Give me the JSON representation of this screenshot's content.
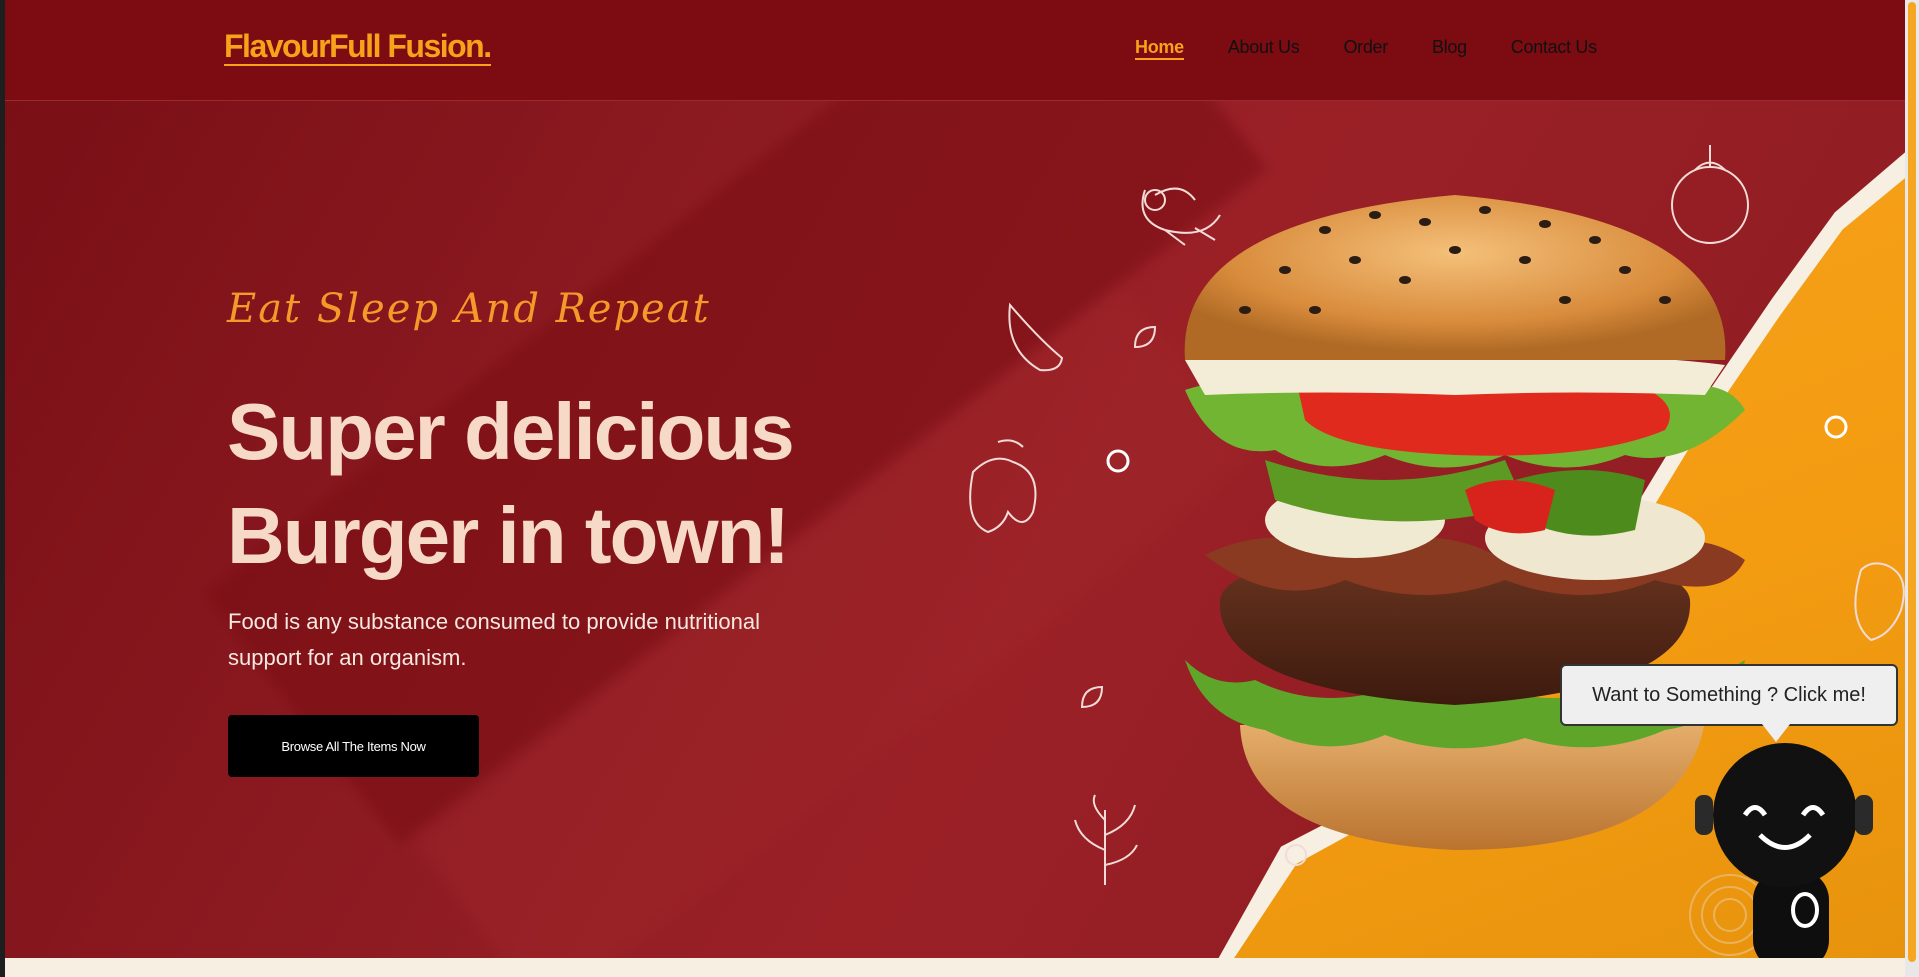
{
  "header": {
    "logo": "FlavourFull Fusion.",
    "nav": [
      {
        "label": "Home",
        "active": true
      },
      {
        "label": "About Us",
        "active": false
      },
      {
        "label": "Order",
        "active": false
      },
      {
        "label": "Blog",
        "active": false
      },
      {
        "label": "Contact Us",
        "active": false
      }
    ]
  },
  "hero": {
    "tagline": "Eat Sleep And Repeat",
    "headline_line1": "Super delicious",
    "headline_line2": "Burger in town!",
    "description": "Food is any substance consumed to provide nutritional support for an organism.",
    "cta_label": "Browse All The Items Now"
  },
  "chatbot": {
    "bubble_text": "Want to Something ? Click me!"
  },
  "colors": {
    "header_bg": "#7c0b12",
    "hero_bg": "#8e1b22",
    "accent": "#f7a21b",
    "headline": "#f6d9c6",
    "cta_bg": "#000000"
  },
  "icons": [
    "shrimp-doodle-icon",
    "garlic-doodle-icon",
    "pepper-doodle-icon",
    "herb-doodle-icon",
    "tomato-doodle-icon",
    "robot-chatbot-icon"
  ]
}
